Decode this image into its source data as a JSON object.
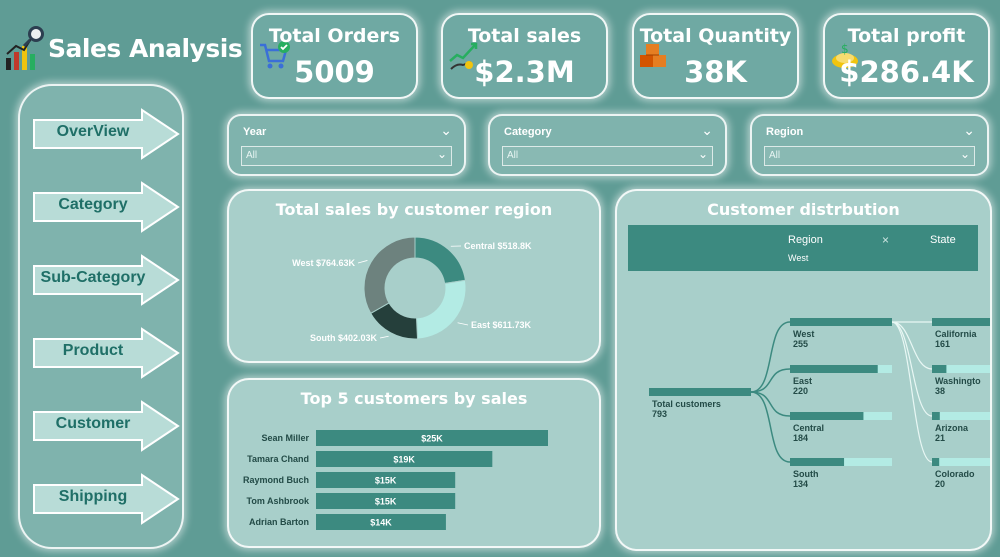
{
  "header": {
    "title": "Sales Analysis",
    "icon": "chart-magnifier-icon"
  },
  "kpis": [
    {
      "label": "Total Orders",
      "value": "5009",
      "icon": "shopping-cart-icon"
    },
    {
      "label": "Total sales",
      "value": "$2.3M",
      "icon": "sales-growth-icon"
    },
    {
      "label": "Total Quantity",
      "value": "38K",
      "icon": "boxes-icon"
    },
    {
      "label": "Total profit",
      "value": "$286.4K",
      "icon": "money-hand-icon"
    }
  ],
  "nav": {
    "items": [
      "OverView",
      "Category",
      "Sub-Category",
      "Product",
      "Customer",
      "Shipping"
    ]
  },
  "slicers": [
    {
      "label": "Year",
      "value": "All"
    },
    {
      "label": "Category",
      "value": "All"
    },
    {
      "label": "Region",
      "value": "All"
    }
  ],
  "donut": {
    "title": "Total sales by customer region",
    "colors": [
      "#3c8a80",
      "#b3ebe4",
      "#253f3b",
      "#6d827e"
    ]
  },
  "bars": {
    "title": "Top 5 customers by sales"
  },
  "tree": {
    "title": "Customer distrbution",
    "header_region": "Region",
    "header_state": "State",
    "selected": "West",
    "close": "×",
    "root": {
      "label": "Total customers",
      "value": "793"
    },
    "regions": [
      {
        "label": "West",
        "value": "255",
        "fill": 1.0
      },
      {
        "label": "East",
        "value": "220",
        "fill": 0.86
      },
      {
        "label": "Central",
        "value": "184",
        "fill": 0.72
      },
      {
        "label": "South",
        "value": "134",
        "fill": 0.53
      }
    ],
    "states": [
      {
        "label": "California",
        "value": "161",
        "fill": 1.0
      },
      {
        "label": "Washingto",
        "value": "38",
        "fill": 0.24
      },
      {
        "label": "Arizona",
        "value": "21",
        "fill": 0.13
      },
      {
        "label": "Colorado",
        "value": "20",
        "fill": 0.12
      }
    ]
  },
  "chart_data": [
    {
      "type": "pie",
      "title": "Total sales by customer region",
      "categories": [
        "Central",
        "East",
        "South",
        "West"
      ],
      "values": [
        518.8,
        611.73,
        402.03,
        764.63
      ],
      "labels": [
        "Central $518.8K",
        "East $611.73K",
        "South $402.03K",
        "West $764.63K"
      ]
    },
    {
      "type": "bar",
      "title": "Top 5 customers by sales",
      "categories": [
        "Sean Miller",
        "Tamara Chand",
        "Raymond Buch",
        "Tom Ashbrook",
        "Adrian Barton"
      ],
      "values": [
        25,
        19,
        15,
        15,
        14
      ],
      "labels": [
        "$25K",
        "$19K",
        "$15K",
        "$15K",
        "$14K"
      ]
    }
  ]
}
